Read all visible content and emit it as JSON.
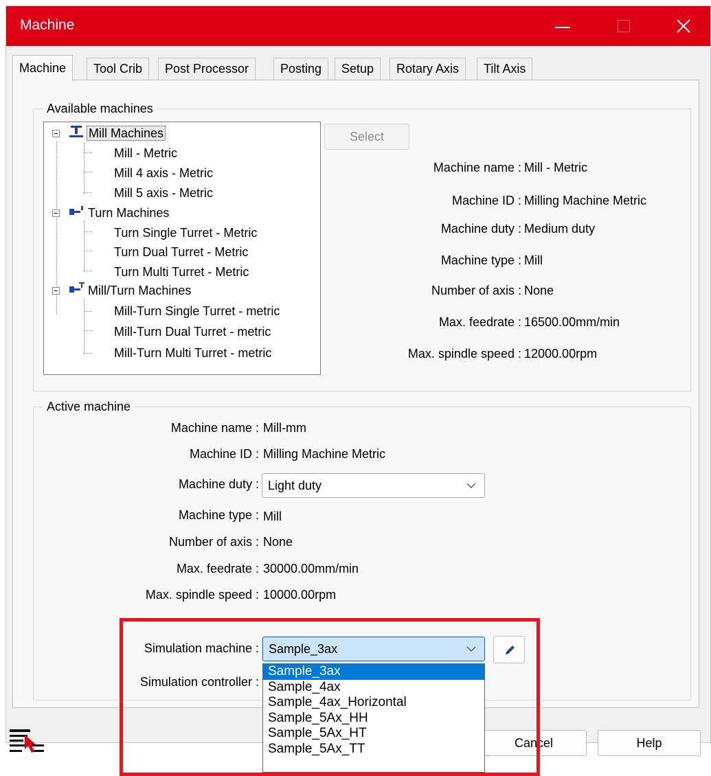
{
  "window": {
    "title": "Machine"
  },
  "tabs": [
    "Machine",
    "Tool Crib",
    "Post Processor",
    "Posting",
    "Setup",
    "Rotary Axis",
    "Tilt Axis"
  ],
  "available": {
    "group_title": "Available machines",
    "select_button": "Select",
    "tree": [
      {
        "label": "Mill Machines",
        "children": [
          "Mill - Metric",
          "Mill 4 axis - Metric",
          "Mill 5 axis - Metric"
        ]
      },
      {
        "label": "Turn Machines",
        "children": [
          "Turn Single Turret - Metric",
          "Turn Dual Turret - Metric",
          "Turn Multi Turret - Metric"
        ]
      },
      {
        "label": "Mill/Turn Machines",
        "children": [
          "Mill-Turn Single Turret - metric",
          "Mill-Turn Dual Turret - metric",
          "Mill-Turn Multi Turret - metric"
        ]
      }
    ],
    "details": {
      "name_label": "Machine name :",
      "name": "Mill - Metric",
      "id_label": "Machine ID :",
      "id": "Milling Machine Metric",
      "duty_label": "Machine duty :",
      "duty": "Medium duty",
      "type_label": "Machine type :",
      "type": "Mill",
      "axis_label": "Number of axis :",
      "axis": "None",
      "feed_label": "Max. feedrate :",
      "feed": "16500.00mm/min",
      "spindle_label": "Max. spindle speed :",
      "spindle": "12000.00rpm"
    }
  },
  "active": {
    "group_title": "Active machine",
    "name_label": "Machine name :",
    "name": "Mill-mm",
    "id_label": "Machine ID :",
    "id": "Milling Machine Metric",
    "duty_label": "Machine duty :",
    "duty": "Light duty",
    "type_label": "Machine type :",
    "type": "Mill",
    "axis_label": "Number of axis :",
    "axis": "None",
    "feed_label": "Max. feedrate :",
    "feed": "30000.00mm/min",
    "spindle_label": "Max. spindle speed :",
    "spindle": "10000.00rpm",
    "sim_machine_label": "Simulation machine :",
    "sim_machine": "Sample_3ax",
    "sim_controller_label": "Simulation controller :",
    "sim_options": [
      "Sample_3ax",
      "Sample_4ax",
      "Sample_4ax_Horizontal",
      "Sample_5Ax_HH",
      "Sample_5Ax_HT",
      "Sample_5Ax_TT"
    ]
  },
  "buttons": {
    "cancel": "Cancel",
    "help": "Help"
  },
  "colors": {
    "titlebar": "#dd0014",
    "highlight": "#e8141e",
    "selection": "#0078d7"
  }
}
